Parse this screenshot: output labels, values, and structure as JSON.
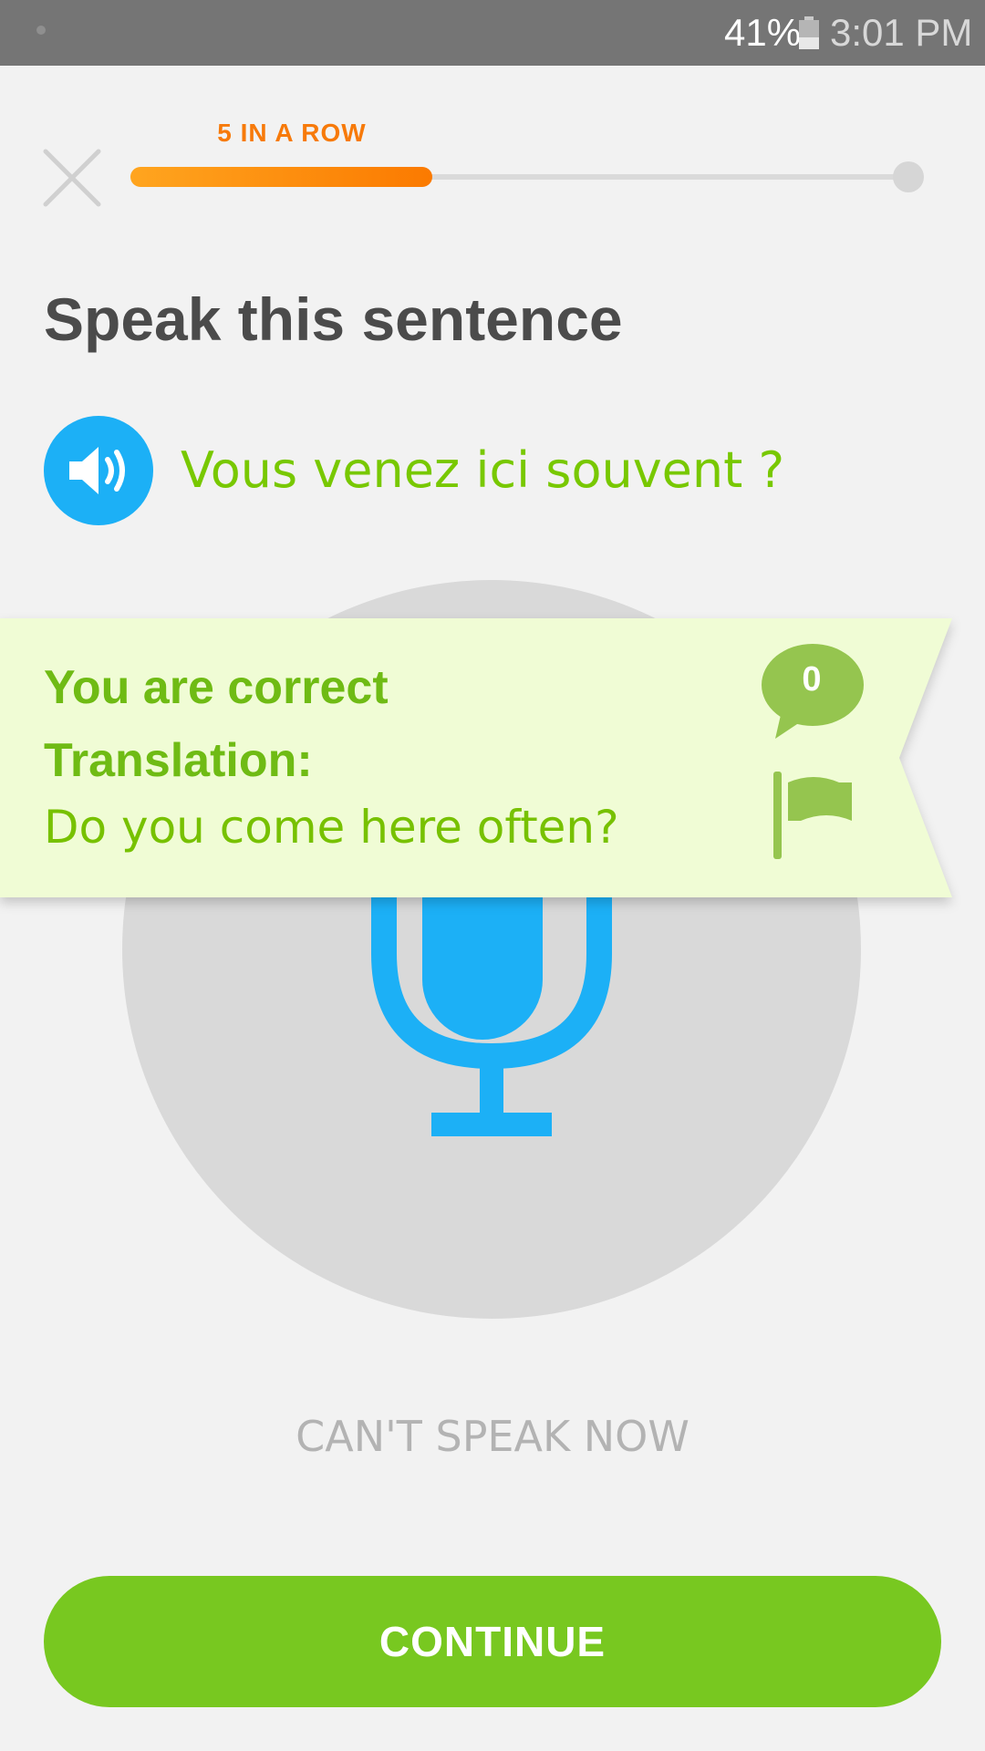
{
  "status_bar": {
    "battery_percent": "41%",
    "battery_level": 0.41,
    "time": "3:01 PM"
  },
  "header": {
    "close_icon": "close-x-icon",
    "streak_label": "5 IN A ROW",
    "progress": 0.38,
    "progress_colors": [
      "#ffa51f",
      "#fb7a00"
    ]
  },
  "exercise": {
    "prompt": "Speak this sentence",
    "speaker_icon": "speaker-icon",
    "sentence": "Vous venez ici souvent ?",
    "microphone_icon": "microphone-icon"
  },
  "feedback": {
    "result": "You are correct",
    "translation_label": "Translation:",
    "translation": "Do you come here often?",
    "comment_count": "0",
    "comment_icon": "comment-bubble-icon",
    "flag_icon": "flag-icon",
    "colors": {
      "background": "#f0fcd5",
      "accent": "#78c800"
    }
  },
  "footer": {
    "cant_speak_label": "CAN'T SPEAK NOW",
    "continue_label": "CONTINUE",
    "continue_color": "#78c820"
  }
}
